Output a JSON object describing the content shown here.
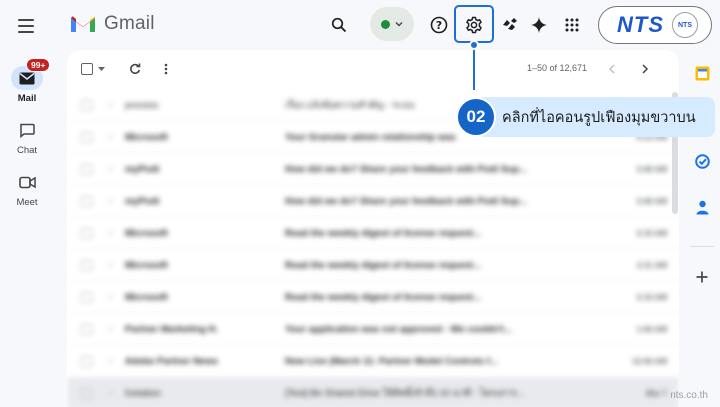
{
  "app": {
    "name": "Gmail"
  },
  "rail": {
    "items": [
      {
        "label": "Mail",
        "icon": "mail-icon",
        "badge": "99+",
        "active": true
      },
      {
        "label": "Chat",
        "icon": "chat-icon"
      },
      {
        "label": "Meet",
        "icon": "video-icon"
      }
    ]
  },
  "header": {
    "icons": [
      "search-icon",
      "help-icon",
      "settings-icon",
      "gemini-icon",
      "sparkle-icon",
      "apps-grid-icon"
    ],
    "status_color": "#1e8e3e",
    "account_logo": "NTS",
    "account_avatar": "NTS"
  },
  "toolbar": {
    "pager": "1–50 of 12,671"
  },
  "mails": [
    {
      "sender": "process",
      "subject": "เรื่อง แจ้งข้อความสำคัญ - ระบบ",
      "date": ""
    },
    {
      "sender": "Microsoft",
      "subject": "Your Granular admin relationship was",
      "date": "6:13 AM"
    },
    {
      "sender": "myPodi",
      "subject": "How did we do? Share your feedback with Podi Sup...",
      "date": "3:40 AM"
    },
    {
      "sender": "myPodi",
      "subject": "How did we do? Share your feedback with Podi Sup...",
      "date": "3:40 AM"
    },
    {
      "sender": "Microsoft",
      "subject": "Read the weekly digest of license request...",
      "date": "2:15 AM"
    },
    {
      "sender": "Microsoft",
      "subject": "Read the weekly digest of license request...",
      "date": "2:11 AM"
    },
    {
      "sender": "Microsoft",
      "subject": "Read the weekly digest of license request...",
      "date": "2:10 AM"
    },
    {
      "sender": "Partner Marketing H.",
      "subject": "Your application was not approved - We couldn't...",
      "date": "1:00 AM"
    },
    {
      "sender": "Adobe Partner News",
      "subject": "Now Live (March 11: Partner Model Controls f...",
      "date": "12:00 AM"
    },
    {
      "sender": "fcetation",
      "subject": "[Test] Be Shared Drive ให้สิทธิ์เข้าถึง 10 นาที - โครงการ...",
      "date": "Mar 7"
    }
  ],
  "callout": {
    "step": "02",
    "text": "คลิกที่ไอคอนรูปเฟืองมุมขวาบน",
    "color": "#1565c8"
  },
  "watermark": "nts.co.th"
}
